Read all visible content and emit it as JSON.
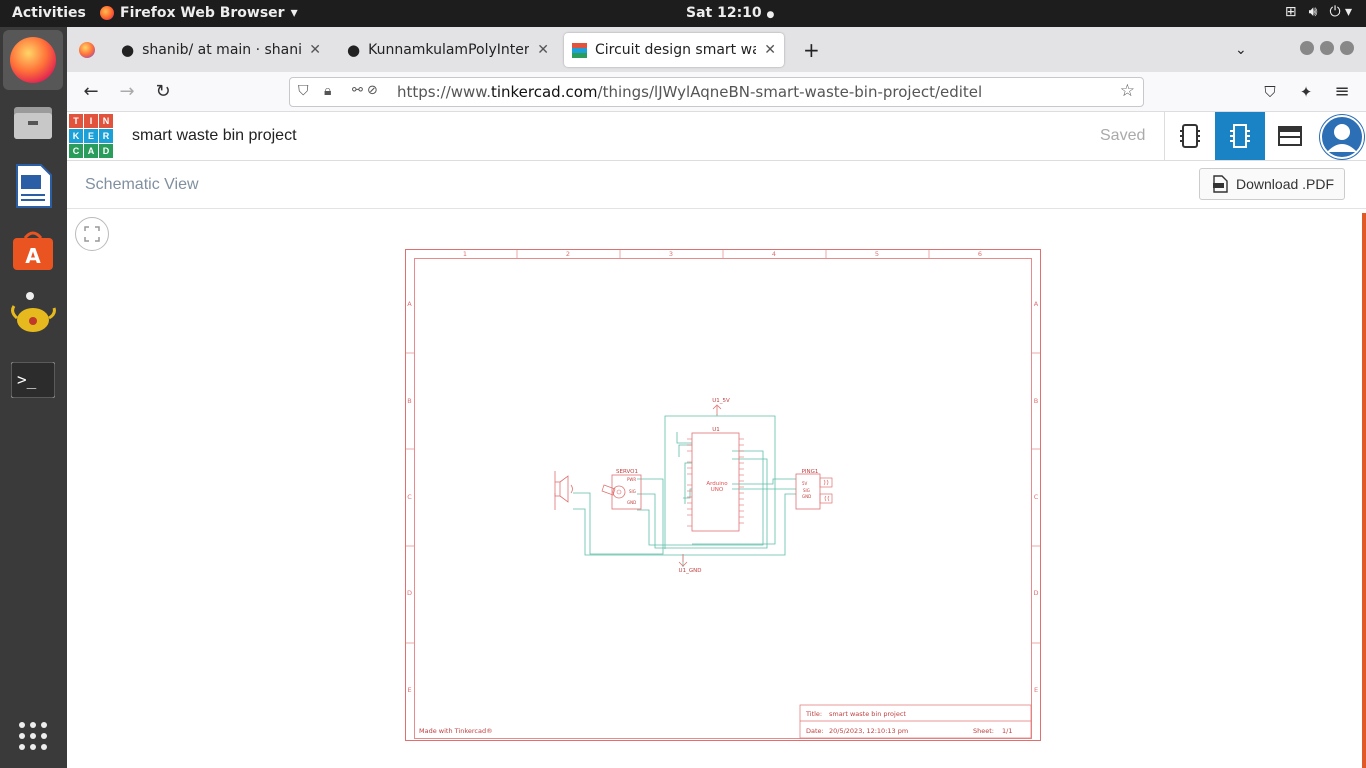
{
  "topbar": {
    "activities": "Activities",
    "app_name": "Firefox Web Browser",
    "clock": "Sat 12:10"
  },
  "browser": {
    "tabs": [
      {
        "label": "shanib/ at main · shanibm"
      },
      {
        "label": "KunnamkulamPolyIntern"
      },
      {
        "label": "Circuit design smart wast"
      }
    ],
    "url_prefix": "https://www.",
    "url_domain": "tinkercad.com",
    "url_path": "/things/lJWylAqneBN-smart-waste-bin-project/editel"
  },
  "tinkercad": {
    "logo_letters": [
      "T",
      "I",
      "N",
      "K",
      "E",
      "R",
      "C",
      "A",
      "D"
    ],
    "logo_colors": [
      "#e2533d",
      "#e2533d",
      "#e2533d",
      "#1ba0d8",
      "#1ba0d8",
      "#1ba0d8",
      "#2a9d5c",
      "#2a9d5c",
      "#2a9d5c"
    ],
    "project_title": "smart waste bin project",
    "save_status": "Saved",
    "accent": "#1a83c6"
  },
  "schematic": {
    "view_title": "Schematic View",
    "download_label": "Download .PDF",
    "col_labels": [
      "1",
      "2",
      "3",
      "4",
      "5",
      "6"
    ],
    "row_labels": [
      "A",
      "B",
      "C",
      "D",
      "E"
    ],
    "made_with": "Made with Tinkercad®",
    "title_label": "Title:",
    "title_value": "smart waste bin project",
    "date_label": "Date:",
    "date_value": "20/5/2023, 12:10:13 pm",
    "sheet_label": "Sheet:",
    "sheet_value": "1/1",
    "components": {
      "u1": "U1",
      "u1_5v": "U1_5V",
      "u1_gnd": "U1_GND",
      "arduino": "Arduino",
      "uno": "UNO",
      "servo": "SERVO1",
      "ping": "PING1",
      "servo_pins": [
        "PWR",
        "SIG",
        "GND"
      ],
      "ping_pins": [
        "5V",
        "SIG",
        "GND"
      ]
    }
  }
}
